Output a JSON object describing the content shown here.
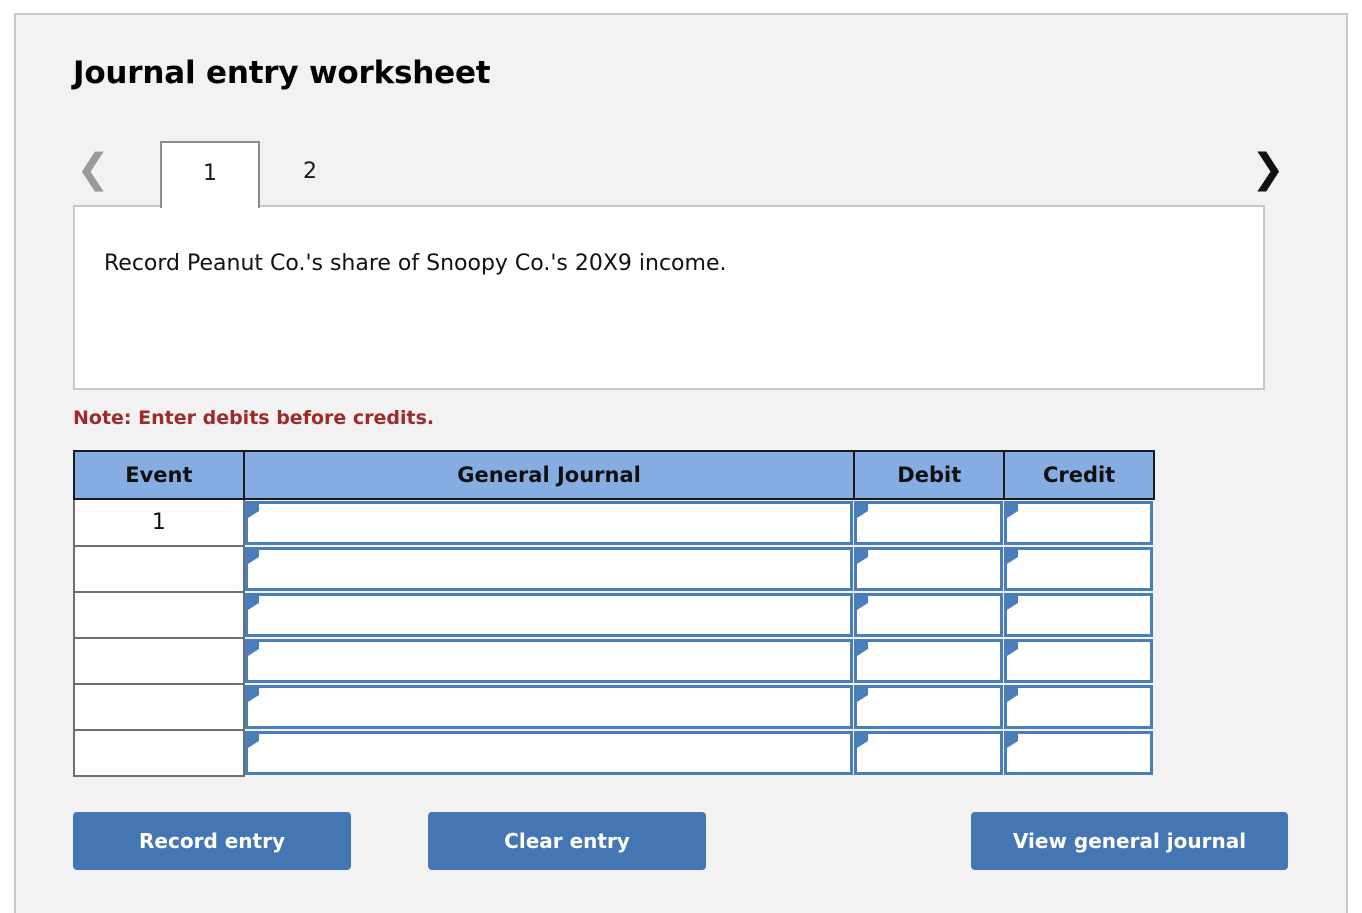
{
  "page": {
    "title": "Journal entry worksheet"
  },
  "tabs": {
    "prev_icon": "chevron-left-icon",
    "next_icon": "chevron-right-icon",
    "items": [
      {
        "label": "1",
        "active": true
      },
      {
        "label": "2",
        "active": false
      }
    ]
  },
  "description": {
    "text": "Record Peanut Co.'s share of Snoopy Co.'s 20X9 income."
  },
  "note": {
    "text": "Note: Enter debits before credits."
  },
  "table": {
    "headers": {
      "event": "Event",
      "general_journal": "General Journal",
      "debit": "Debit",
      "credit": "Credit"
    },
    "rows": [
      {
        "event": "1",
        "general_journal": "",
        "debit": "",
        "credit": ""
      },
      {
        "event": "",
        "general_journal": "",
        "debit": "",
        "credit": ""
      },
      {
        "event": "",
        "general_journal": "",
        "debit": "",
        "credit": ""
      },
      {
        "event": "",
        "general_journal": "",
        "debit": "",
        "credit": ""
      },
      {
        "event": "",
        "general_journal": "",
        "debit": "",
        "credit": ""
      },
      {
        "event": "",
        "general_journal": "",
        "debit": "",
        "credit": ""
      }
    ]
  },
  "buttons": {
    "record": "Record entry",
    "clear": "Clear entry",
    "view": "View general journal"
  },
  "colors": {
    "header_blue": "#85ade2",
    "button_blue": "#4476b4",
    "field_border_blue": "#4a7ebb",
    "note_red": "#9c2b2b",
    "panel_bg": "#f2f2f2"
  }
}
